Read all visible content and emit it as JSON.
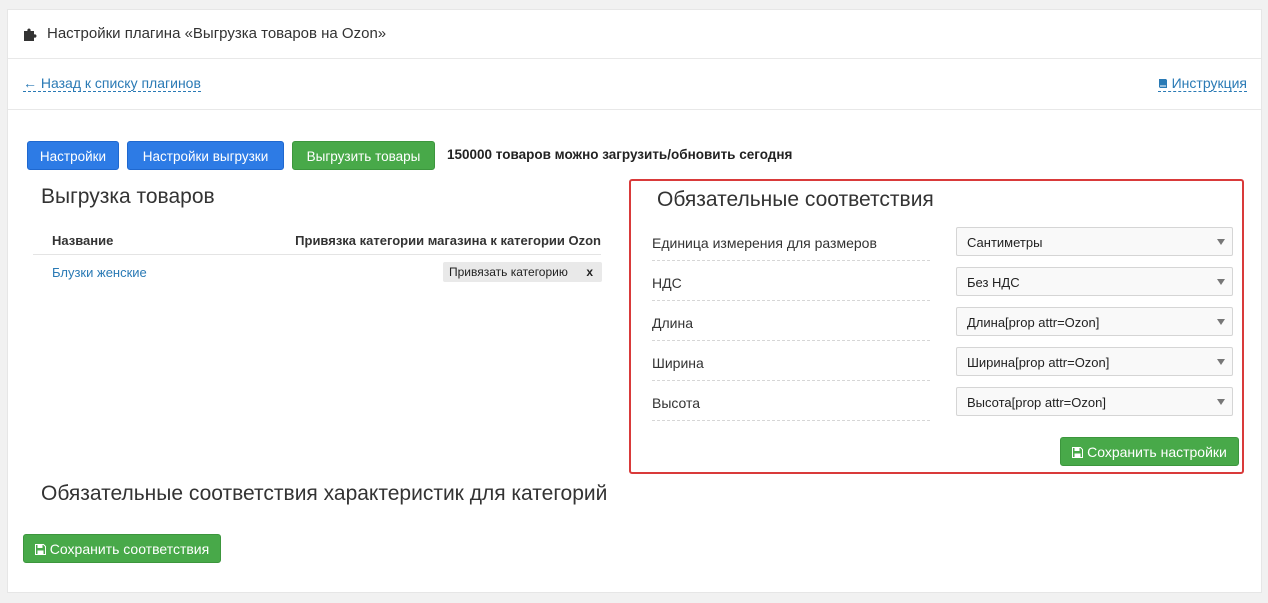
{
  "header": {
    "title": "Настройки плагина «Выгрузка товаров на Ozon»"
  },
  "nav": {
    "back": "← Назад к списку плагинов",
    "help": "Инструкция"
  },
  "toolbar": {
    "settings": "Настройки",
    "export_settings": "Настройки выгрузки",
    "upload": "Выгрузить товары",
    "limit": "150000 товаров можно загрузить/обновить сегодня"
  },
  "export": {
    "title": "Выгрузка товаров",
    "columns": [
      "Название",
      "Привязка категории магазина к категории Ozon"
    ],
    "rows": [
      {
        "name": "Блузки женские",
        "action": "Привязать категорию",
        "remove": "x"
      }
    ]
  },
  "mandatory": {
    "title": "Обязательные соответствия",
    "fields": [
      {
        "label": "Единица измерения для размеров",
        "value": "Сантиметры"
      },
      {
        "label": "НДС",
        "value": "Без НДС"
      },
      {
        "label": "Длина",
        "value": "Длина[prop attr=Ozon]"
      },
      {
        "label": "Ширина",
        "value": "Ширина[prop attr=Ozon]"
      },
      {
        "label": "Высота",
        "value": "Высота[prop attr=Ozon]"
      }
    ],
    "save": "Сохранить настройки"
  },
  "characteristics": {
    "title": "Обязательные соответствия характеристик для категорий",
    "save": "Сохранить соответствия"
  },
  "colors": {
    "blue": "#2d7be5",
    "green": "#48a949",
    "highlight": "#d93a3a",
    "link": "#2a7ab5"
  },
  "icons": {
    "header": "puzzle-icon",
    "help": "book-icon",
    "save": "floppy-icon"
  }
}
